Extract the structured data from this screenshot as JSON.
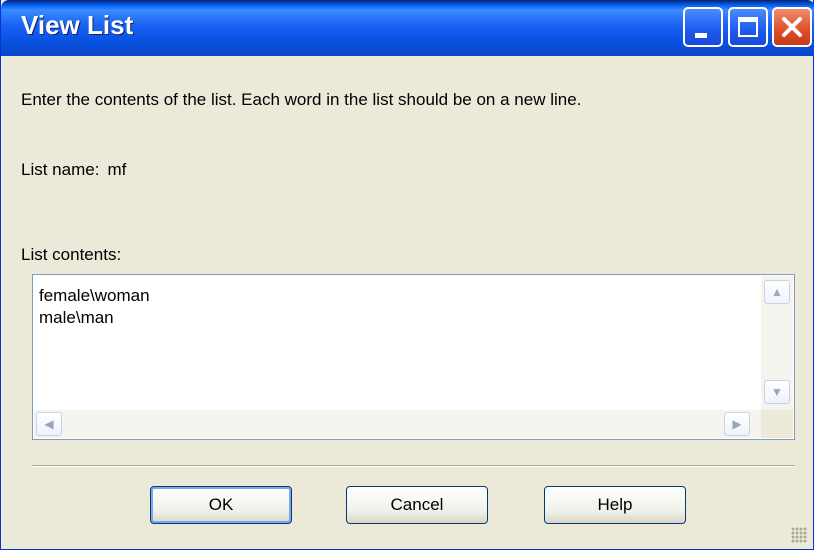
{
  "window": {
    "title": "View List",
    "controls": {
      "minimize_icon": "minimize-icon",
      "maximize_icon": "maximize-icon",
      "close_icon": "close-icon"
    }
  },
  "instruction": "Enter the contents of the list. Each word in the list should be on a new line.",
  "list_name": {
    "label": "List name:",
    "value": "mf"
  },
  "list_contents": {
    "label": "List contents:",
    "value": "female\\woman\nmale\\man"
  },
  "buttons": {
    "ok": "OK",
    "cancel": "Cancel",
    "help": "Help"
  },
  "colors": {
    "titlebar": "#0a46c8",
    "dialog_bg": "#ece9d8",
    "close_button": "#e0522c"
  }
}
